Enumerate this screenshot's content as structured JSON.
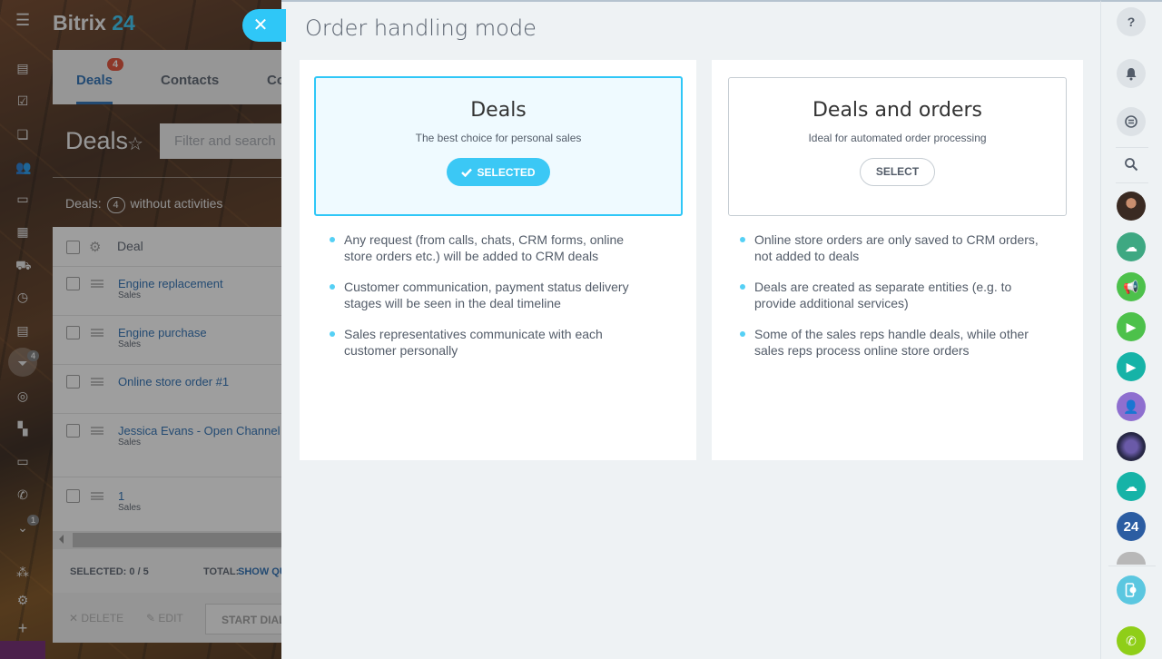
{
  "background_app": {
    "logo": {
      "text": "Bitrix",
      "number": "24"
    },
    "tabs": [
      {
        "label": "Deals",
        "badge": "4",
        "active": true
      },
      {
        "label": "Contacts",
        "active": false
      },
      {
        "label": "Co",
        "active": false
      }
    ],
    "page_title": "Deals",
    "filter_placeholder": "Filter and search",
    "deals_counter": {
      "prefix": "Deals:",
      "count": "4",
      "suffix": "without activities"
    },
    "grid": {
      "column_header": "Deal",
      "rows": [
        {
          "title": "Engine replacement",
          "subtitle": "Sales"
        },
        {
          "title": "Engine purchase",
          "subtitle": "Sales"
        },
        {
          "title": "Online store order #1",
          "subtitle": ""
        },
        {
          "title": "Jessica Evans - Open Channel",
          "subtitle": "Sales"
        },
        {
          "title": "1",
          "subtitle": "Sales"
        }
      ]
    },
    "footer": {
      "selected_label": "SELECTED: 0 / 5",
      "total_label": "TOTAL:",
      "total_link": "SHOW QU"
    },
    "actions": {
      "delete": "DELETE",
      "edit": "EDIT",
      "start_dial": "START DIAL"
    },
    "nav_badges": {
      "funnel": "4",
      "more": "1"
    }
  },
  "slider": {
    "title": "Order handling mode",
    "close_icon": "close-icon",
    "modes": [
      {
        "title": "Deals",
        "subtitle": "The best choice for personal sales",
        "button_label": "SELECTED",
        "selected": true,
        "features": [
          "Any request (from calls, chats, CRM forms, online store orders etc.) will be added to CRM deals",
          "Customer communication, payment status delivery stages will be seen in the deal timeline",
          "Sales representatives communicate with each customer personally"
        ]
      },
      {
        "title": "Deals and orders",
        "subtitle": "Ideal for automated order processing",
        "button_label": "SELECT",
        "selected": false,
        "features": [
          "Online store orders are only saved to CRM orders, not added to deals",
          "Deals are created as separate entities (e.g. to provide additional services)",
          "Some of the sales reps handle deals, while other sales reps process online store orders"
        ]
      }
    ],
    "accent_color": "#2fc7f7"
  },
  "right_bar": {
    "items": [
      {
        "icon": "help-icon"
      },
      {
        "icon": "bell-icon"
      },
      {
        "icon": "chat-icon"
      },
      {
        "icon": "search-icon"
      },
      {
        "icon": "user-avatar"
      },
      {
        "icon": "cloud-icon",
        "color": "#3ea882"
      },
      {
        "icon": "megaphone-icon",
        "color": "#4dc14b"
      },
      {
        "icon": "video-icon",
        "color": "#4dc14b"
      },
      {
        "icon": "video-icon",
        "color": "#16b3a7"
      },
      {
        "icon": "person-icon",
        "color": "#8e6fcf"
      },
      {
        "icon": "group-avatar"
      },
      {
        "icon": "cloud-icon",
        "color": "#16b3a7"
      },
      {
        "icon": "b24-icon",
        "label": "24",
        "color": "#2b5da2"
      },
      {
        "icon": "user-avatar"
      },
      {
        "icon": "mobile-cloud-icon",
        "color": "#5bc7e0"
      },
      {
        "icon": "phone-icon",
        "color": "#8fce18"
      }
    ]
  }
}
